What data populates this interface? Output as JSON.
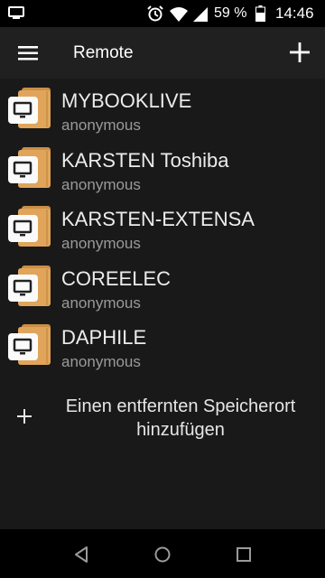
{
  "status_bar": {
    "battery_percent": "59 %",
    "time": "14:46",
    "icons": [
      "screen-cast-icon",
      "alarm-icon",
      "wifi-icon",
      "signal-icon",
      "battery-icon"
    ]
  },
  "app_bar": {
    "title": "Remote",
    "menu_icon": "hamburger-menu-icon",
    "add_icon": "plus-icon"
  },
  "locations": [
    {
      "name": "MYBOOKLIVE",
      "user": "anonymous"
    },
    {
      "name": "KARSTEN Toshiba",
      "user": "anonymous"
    },
    {
      "name": "KARSTEN-EXTENSA",
      "user": "anonymous"
    },
    {
      "name": "COREELEC",
      "user": "anonymous"
    },
    {
      "name": "DAPHILE",
      "user": "anonymous"
    }
  ],
  "add_location": {
    "line1": "Einen entfernten Speicherort",
    "line2": "hinzufügen"
  },
  "colors": {
    "background": "#191919",
    "app_bar": "#202020",
    "folder": "#e0a55a",
    "folder_dark": "#c98f45"
  }
}
